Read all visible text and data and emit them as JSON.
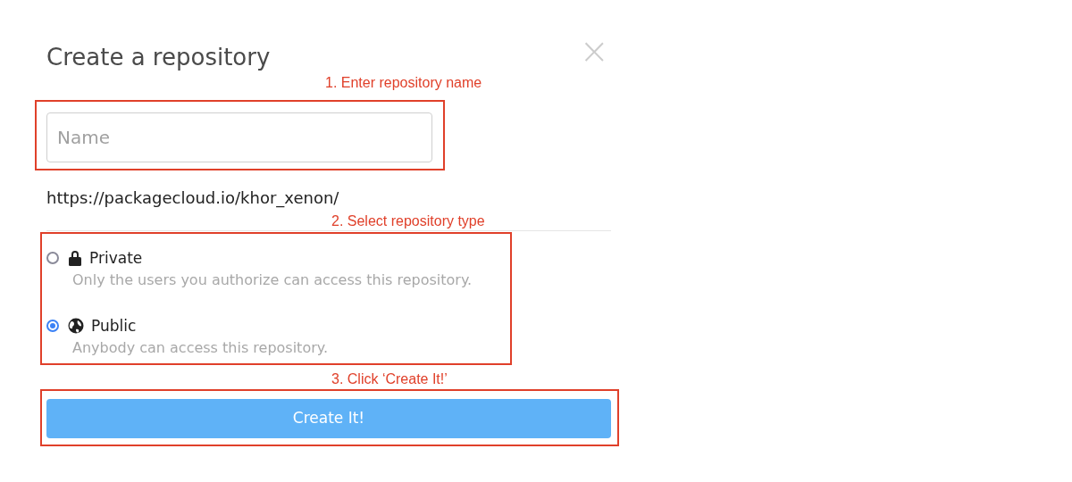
{
  "dialog": {
    "title": "Create a repository",
    "close": "×",
    "name_field": {
      "placeholder": "Name"
    },
    "url": "https://packagecloud.io/khor_xenon/",
    "options": [
      {
        "kind": "lock",
        "label": "Private",
        "description": "Only the users you authorize can access this repository.",
        "selected": false
      },
      {
        "kind": "globe",
        "label": "Public",
        "description": "Anybody can access this repository.",
        "selected": true
      }
    ],
    "button": "Create It!"
  },
  "annotations": [
    {
      "label": "1. Enter repository name"
    },
    {
      "label": "2. Select repository type"
    },
    {
      "label": "3. Click ‘Create It!’"
    }
  ]
}
